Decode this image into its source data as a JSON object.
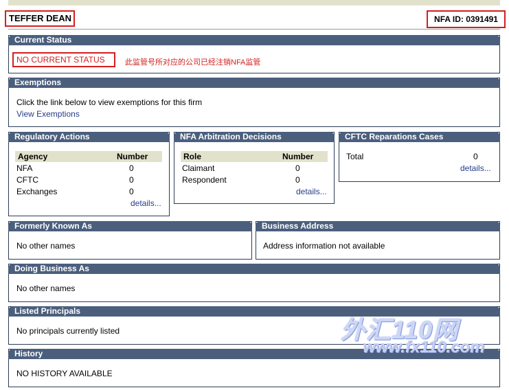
{
  "header": {
    "firm_name": "TEFFER DEAN",
    "nfa_id": "NFA ID: 0391491"
  },
  "current_status": {
    "title": "Current Status",
    "status": "NO CURRENT STATUS",
    "note": "此监管号所对应的公司已经注销NFA监管"
  },
  "exemptions": {
    "title": "Exemptions",
    "text": "Click the link below to view exemptions for this firm",
    "link": "View Exemptions"
  },
  "regulatory_actions": {
    "title": "Regulatory Actions",
    "columns": [
      "Agency",
      "Number"
    ],
    "rows": [
      {
        "label": "NFA",
        "value": "0"
      },
      {
        "label": "CFTC",
        "value": "0"
      },
      {
        "label": "Exchanges",
        "value": "0"
      }
    ],
    "details": "details..."
  },
  "arbitration": {
    "title": "NFA Arbitration Decisions",
    "columns": [
      "Role",
      "Number"
    ],
    "rows": [
      {
        "label": "Claimant",
        "value": "0"
      },
      {
        "label": "Respondent",
        "value": "0"
      }
    ],
    "details": "details..."
  },
  "reparations": {
    "title": "CFTC Reparations Cases",
    "total_label": "Total",
    "total_value": "0",
    "details": "details..."
  },
  "formerly_known": {
    "title": "Formerly Known As",
    "text": "No other names"
  },
  "business_address": {
    "title": "Business Address",
    "text": "Address information not available"
  },
  "doing_business": {
    "title": "Doing Business As",
    "text": "No other names"
  },
  "principals": {
    "title": "Listed Principals",
    "text": "No principals currently listed"
  },
  "history": {
    "title": "History",
    "text": "NO HISTORY AVAILABLE"
  },
  "watermark": {
    "logo": "外汇110网",
    "url": "www.fx110.com"
  },
  "colors": {
    "panel_header": "#4b5f7d",
    "highlight_red": "#d21e1e",
    "table_header": "#e2e2cc",
    "link": "#263c8a"
  }
}
